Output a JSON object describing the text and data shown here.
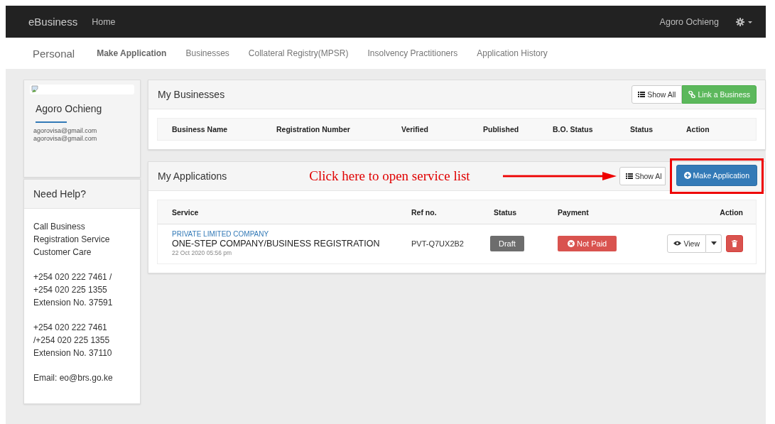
{
  "navbar": {
    "brand": "eBusiness",
    "links": [
      "Home"
    ],
    "user": "Agoro Ochieng"
  },
  "subnav": {
    "title": "Personal",
    "tabs": [
      {
        "label": "Make Application",
        "selected": true
      },
      {
        "label": "Businesses",
        "selected": false
      },
      {
        "label": "Collateral Registry(MPSR)",
        "selected": false
      },
      {
        "label": "Insolvency Practitioners",
        "selected": false
      },
      {
        "label": "Application History",
        "selected": false
      }
    ]
  },
  "profile": {
    "name": "Agoro Ochieng",
    "emails": [
      "agorovisa@gmail.com",
      "agorovisa@gmail.com"
    ]
  },
  "help": {
    "title": "Need Help?",
    "paragraphs": [
      [
        "Call Business",
        "Registration Service",
        "Customer Care"
      ],
      [
        "+254 020 222 7461 /",
        "+254 020 225 1355",
        "Extension No. 37591"
      ],
      [
        "+254 020 222 7461",
        "/+254 020 225 1355",
        "Extension No. 37110"
      ],
      [
        "Email: eo@brs.go.ke"
      ]
    ]
  },
  "businesses": {
    "title": "My Businesses",
    "buttons": [
      {
        "label": "Show All",
        "kind": "default"
      },
      {
        "label": "Link a Business",
        "kind": "success"
      }
    ],
    "columns": [
      "Business Name",
      "Registration Number",
      "Verified",
      "Published",
      "B.O. Status",
      "Status",
      "Action"
    ]
  },
  "applications": {
    "title": "My Applications",
    "annotation": "Click here to open service list",
    "show_all": "Show Al",
    "make_button": "Make Application",
    "columns": [
      "Service",
      "Ref no.",
      "Status",
      "Payment",
      "Action"
    ],
    "rows": [
      {
        "category": "PRIVATE LIMITED COMPANY",
        "service": "ONE-STEP COMPANY/BUSINESS REGISTRATION",
        "date": "22 Oct 2020 05:56 pm",
        "ref": "PVT-Q7UX2B2",
        "status": {
          "label": "Draft",
          "kind": "draft"
        },
        "payment": {
          "label": "Not Paid",
          "kind": "unpaid"
        },
        "view": "View"
      }
    ]
  }
}
